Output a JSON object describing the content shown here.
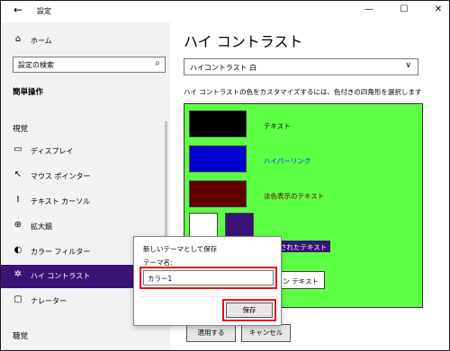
{
  "window": {
    "title": "設定",
    "back_icon": "←",
    "minimize_icon": "—",
    "maximize_icon": "☐",
    "close_icon": "✕"
  },
  "sidebar": {
    "home": {
      "icon": "⌂",
      "label": "ホーム"
    },
    "search": {
      "placeholder": "設定の検索",
      "icon": "⌕"
    },
    "section_title": "簡単操作",
    "category_vision": "視覚",
    "items": [
      {
        "icon": "▭",
        "label": "ディスプレイ"
      },
      {
        "icon": "↖",
        "label": "マウス ポインター"
      },
      {
        "icon": "I",
        "label": "テキスト カーソル"
      },
      {
        "icon": "⊕",
        "label": "拡大鏡"
      },
      {
        "icon": "◐",
        "label": "カラー フィルター"
      },
      {
        "icon": "✲",
        "label": "ハイ コントラスト"
      },
      {
        "icon": "▢",
        "label": "ナレーター"
      }
    ],
    "category_hearing": "聴覚"
  },
  "main": {
    "title": "ハイ コントラスト",
    "theme_select_value": "ハイコントラスト 白",
    "chevron_icon": "∨",
    "description": "ハイ コントラストの色をカスタマイズするには、色付きの四角形を選択します",
    "swatches": [
      {
        "label": "テキスト",
        "color": "#000000",
        "label_color": "#000000"
      },
      {
        "label": "ハイパーリンク",
        "color": "#0000cc",
        "label_color": "#1a1aff"
      },
      {
        "label": "淡色表示のテキスト",
        "color": "#600000",
        "label_color": "#600000"
      }
    ],
    "selected_text_label": "選択されたテキスト",
    "button_text_label": "ン テキスト",
    "apply_button": "適用する",
    "cancel_button": "キャンセル",
    "panel_color": "#5dff45"
  },
  "dialog": {
    "title": "新しいテーマとして保存",
    "name_label": "テーマ名:",
    "name_value": "カラー1",
    "save_button": "保存"
  }
}
